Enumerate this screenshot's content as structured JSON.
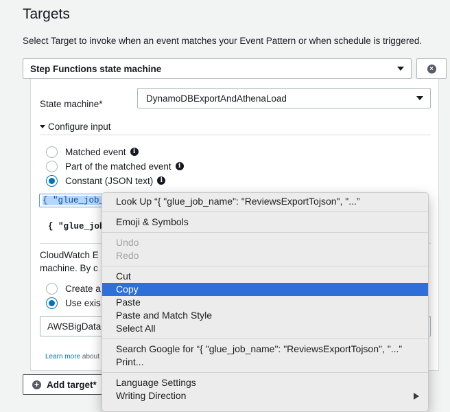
{
  "section": {
    "title": "Targets",
    "description": "Select Target to invoke when an event matches your Event Pattern or when schedule is triggered."
  },
  "target": {
    "type_value": "Step Functions state machine",
    "remove_icon": "x-circle-icon"
  },
  "form": {
    "state_machine_label": "State machine*",
    "state_machine_value": "DynamoDBExportAndAthenaLoad",
    "configure_input_label": "Configure input",
    "radio_options": [
      {
        "label": "Matched event",
        "selected": false
      },
      {
        "label": "Part of the matched event",
        "selected": false
      },
      {
        "label": "Constant (JSON text)",
        "selected": true
      }
    ],
    "json_input_value": "{  \"glue_job_n",
    "json_preview": "{ \"glue_job_n",
    "help_line1": "CloudWatch E",
    "help_line2": "machine. By c",
    "role_options": [
      {
        "label": "Create a",
        "selected": false
      },
      {
        "label": "Use exis",
        "selected": true
      }
    ],
    "role_value": "AWSBigData",
    "learn_more": "Learn more",
    "learn_more_rest": "about"
  },
  "add_target_label": "Add target*",
  "context_menu": {
    "groups": [
      [
        {
          "label": "Look Up “{  \"glue_job_name\": \"ReviewsExportTojson\",  \"...”",
          "disabled": false
        }
      ],
      [
        {
          "label": "Emoji & Symbols",
          "disabled": false
        }
      ],
      [
        {
          "label": "Undo",
          "disabled": true
        },
        {
          "label": "Redo",
          "disabled": true
        }
      ],
      [
        {
          "label": "Cut",
          "disabled": false
        },
        {
          "label": "Copy",
          "disabled": false,
          "highlighted": true
        },
        {
          "label": "Paste",
          "disabled": false
        },
        {
          "label": "Paste and Match Style",
          "disabled": false
        },
        {
          "label": "Select All",
          "disabled": false
        }
      ],
      [
        {
          "label": "Search Google for “{  \"glue_job_name\": \"ReviewsExportTojson\",  \"...”",
          "disabled": false
        },
        {
          "label": "Print...",
          "disabled": false
        }
      ],
      [
        {
          "label": "Language Settings",
          "disabled": false
        },
        {
          "label": "Writing Direction",
          "disabled": false,
          "submenu": true
        }
      ]
    ]
  },
  "colors": {
    "accent": "#0073bb",
    "menu_highlight": "#2e6fd8",
    "background": "#f2f3f3"
  }
}
